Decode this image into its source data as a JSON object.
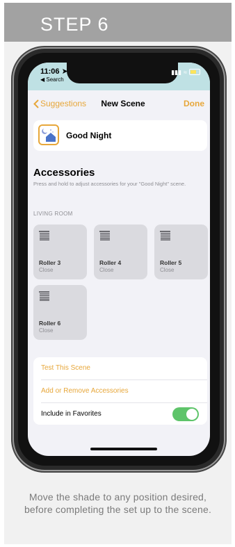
{
  "step": {
    "label": "STEP 6"
  },
  "status": {
    "time": "11:06",
    "back_app": "Search"
  },
  "nav": {
    "back_label": "Suggestions",
    "title": "New Scene",
    "done_label": "Done"
  },
  "scene": {
    "name": "Good Night",
    "icon": "moon-house-icon"
  },
  "accessories": {
    "heading": "Accessories",
    "description": "Press and hold to adjust accessories for your \"Good Night\" scene.",
    "room": "LIVING ROOM",
    "tiles": [
      {
        "name": "Roller 3",
        "state": "Close"
      },
      {
        "name": "Roller 4",
        "state": "Close"
      },
      {
        "name": "Roller 5",
        "state": "Close"
      },
      {
        "name": "Roller 6",
        "state": "Close"
      }
    ]
  },
  "actions": {
    "test_label": "Test This Scene",
    "add_remove_label": "Add or Remove Accessories",
    "favorites_label": "Include in Favorites",
    "favorites_on": true
  },
  "caption": "Move the shade to any position desired, before completing the set up to the scene.",
  "colors": {
    "accent": "#e7a73a",
    "toggle_on": "#5ec46a",
    "header_bg": "#a2a2a2",
    "status_bg": "#bfe1e4"
  }
}
